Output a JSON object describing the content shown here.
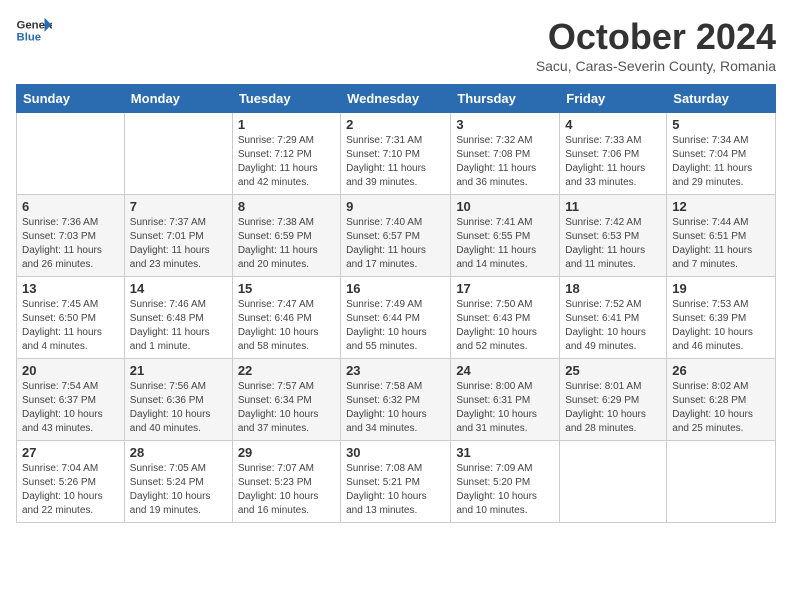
{
  "header": {
    "logo_line1": "General",
    "logo_line2": "Blue",
    "month": "October 2024",
    "location": "Sacu, Caras-Severin County, Romania"
  },
  "weekdays": [
    "Sunday",
    "Monday",
    "Tuesday",
    "Wednesday",
    "Thursday",
    "Friday",
    "Saturday"
  ],
  "weeks": [
    [
      {
        "day": "",
        "info": ""
      },
      {
        "day": "",
        "info": ""
      },
      {
        "day": "1",
        "info": "Sunrise: 7:29 AM\nSunset: 7:12 PM\nDaylight: 11 hours and 42 minutes."
      },
      {
        "day": "2",
        "info": "Sunrise: 7:31 AM\nSunset: 7:10 PM\nDaylight: 11 hours and 39 minutes."
      },
      {
        "day": "3",
        "info": "Sunrise: 7:32 AM\nSunset: 7:08 PM\nDaylight: 11 hours and 36 minutes."
      },
      {
        "day": "4",
        "info": "Sunrise: 7:33 AM\nSunset: 7:06 PM\nDaylight: 11 hours and 33 minutes."
      },
      {
        "day": "5",
        "info": "Sunrise: 7:34 AM\nSunset: 7:04 PM\nDaylight: 11 hours and 29 minutes."
      }
    ],
    [
      {
        "day": "6",
        "info": "Sunrise: 7:36 AM\nSunset: 7:03 PM\nDaylight: 11 hours and 26 minutes."
      },
      {
        "day": "7",
        "info": "Sunrise: 7:37 AM\nSunset: 7:01 PM\nDaylight: 11 hours and 23 minutes."
      },
      {
        "day": "8",
        "info": "Sunrise: 7:38 AM\nSunset: 6:59 PM\nDaylight: 11 hours and 20 minutes."
      },
      {
        "day": "9",
        "info": "Sunrise: 7:40 AM\nSunset: 6:57 PM\nDaylight: 11 hours and 17 minutes."
      },
      {
        "day": "10",
        "info": "Sunrise: 7:41 AM\nSunset: 6:55 PM\nDaylight: 11 hours and 14 minutes."
      },
      {
        "day": "11",
        "info": "Sunrise: 7:42 AM\nSunset: 6:53 PM\nDaylight: 11 hours and 11 minutes."
      },
      {
        "day": "12",
        "info": "Sunrise: 7:44 AM\nSunset: 6:51 PM\nDaylight: 11 hours and 7 minutes."
      }
    ],
    [
      {
        "day": "13",
        "info": "Sunrise: 7:45 AM\nSunset: 6:50 PM\nDaylight: 11 hours and 4 minutes."
      },
      {
        "day": "14",
        "info": "Sunrise: 7:46 AM\nSunset: 6:48 PM\nDaylight: 11 hours and 1 minute."
      },
      {
        "day": "15",
        "info": "Sunrise: 7:47 AM\nSunset: 6:46 PM\nDaylight: 10 hours and 58 minutes."
      },
      {
        "day": "16",
        "info": "Sunrise: 7:49 AM\nSunset: 6:44 PM\nDaylight: 10 hours and 55 minutes."
      },
      {
        "day": "17",
        "info": "Sunrise: 7:50 AM\nSunset: 6:43 PM\nDaylight: 10 hours and 52 minutes."
      },
      {
        "day": "18",
        "info": "Sunrise: 7:52 AM\nSunset: 6:41 PM\nDaylight: 10 hours and 49 minutes."
      },
      {
        "day": "19",
        "info": "Sunrise: 7:53 AM\nSunset: 6:39 PM\nDaylight: 10 hours and 46 minutes."
      }
    ],
    [
      {
        "day": "20",
        "info": "Sunrise: 7:54 AM\nSunset: 6:37 PM\nDaylight: 10 hours and 43 minutes."
      },
      {
        "day": "21",
        "info": "Sunrise: 7:56 AM\nSunset: 6:36 PM\nDaylight: 10 hours and 40 minutes."
      },
      {
        "day": "22",
        "info": "Sunrise: 7:57 AM\nSunset: 6:34 PM\nDaylight: 10 hours and 37 minutes."
      },
      {
        "day": "23",
        "info": "Sunrise: 7:58 AM\nSunset: 6:32 PM\nDaylight: 10 hours and 34 minutes."
      },
      {
        "day": "24",
        "info": "Sunrise: 8:00 AM\nSunset: 6:31 PM\nDaylight: 10 hours and 31 minutes."
      },
      {
        "day": "25",
        "info": "Sunrise: 8:01 AM\nSunset: 6:29 PM\nDaylight: 10 hours and 28 minutes."
      },
      {
        "day": "26",
        "info": "Sunrise: 8:02 AM\nSunset: 6:28 PM\nDaylight: 10 hours and 25 minutes."
      }
    ],
    [
      {
        "day": "27",
        "info": "Sunrise: 7:04 AM\nSunset: 5:26 PM\nDaylight: 10 hours and 22 minutes."
      },
      {
        "day": "28",
        "info": "Sunrise: 7:05 AM\nSunset: 5:24 PM\nDaylight: 10 hours and 19 minutes."
      },
      {
        "day": "29",
        "info": "Sunrise: 7:07 AM\nSunset: 5:23 PM\nDaylight: 10 hours and 16 minutes."
      },
      {
        "day": "30",
        "info": "Sunrise: 7:08 AM\nSunset: 5:21 PM\nDaylight: 10 hours and 13 minutes."
      },
      {
        "day": "31",
        "info": "Sunrise: 7:09 AM\nSunset: 5:20 PM\nDaylight: 10 hours and 10 minutes."
      },
      {
        "day": "",
        "info": ""
      },
      {
        "day": "",
        "info": ""
      }
    ]
  ]
}
